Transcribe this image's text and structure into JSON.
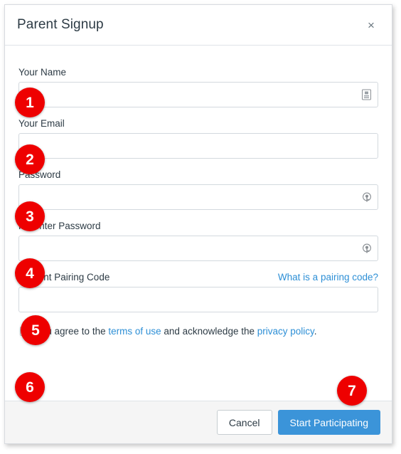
{
  "dialog": {
    "title": "Parent Signup",
    "close_icon": "close-icon",
    "close_label": "×"
  },
  "form": {
    "fields": [
      {
        "label": "Your Name",
        "value": "",
        "placeholder": "",
        "type": "text",
        "icon": "contact-card-autofill-icon"
      },
      {
        "label": "Your Email",
        "value": "",
        "placeholder": "",
        "type": "email",
        "icon": ""
      },
      {
        "label": "Password",
        "value": "",
        "placeholder": "",
        "type": "password",
        "icon": "key-password-manager-icon"
      },
      {
        "label": "Re-enter Password",
        "value": "",
        "placeholder": "",
        "type": "password",
        "icon": "key-password-manager-icon"
      },
      {
        "label": "Student Pairing Code",
        "value": "",
        "placeholder": "",
        "type": "text",
        "icon": "",
        "helper_link": "What is a pairing code?"
      }
    ],
    "terms": {
      "checked": false,
      "prefix": "You agree to the ",
      "terms_link": "terms of use",
      "middle": " and acknowledge the ",
      "privacy_link": "privacy policy",
      "suffix": "."
    }
  },
  "footer": {
    "cancel_label": "Cancel",
    "submit_label": "Start Participating"
  },
  "badges": [
    {
      "number": "1"
    },
    {
      "number": "2"
    },
    {
      "number": "3"
    },
    {
      "number": "4"
    },
    {
      "number": "5"
    },
    {
      "number": "6"
    },
    {
      "number": "7"
    }
  ],
  "colors": {
    "badge_red": "#EE0000",
    "primary_blue": "#3B94D9",
    "link_blue": "#2D8FD6",
    "text_dark": "#2D3B45",
    "footer_bg": "#F5F5F5",
    "border_gray": "#D3D9DE"
  }
}
